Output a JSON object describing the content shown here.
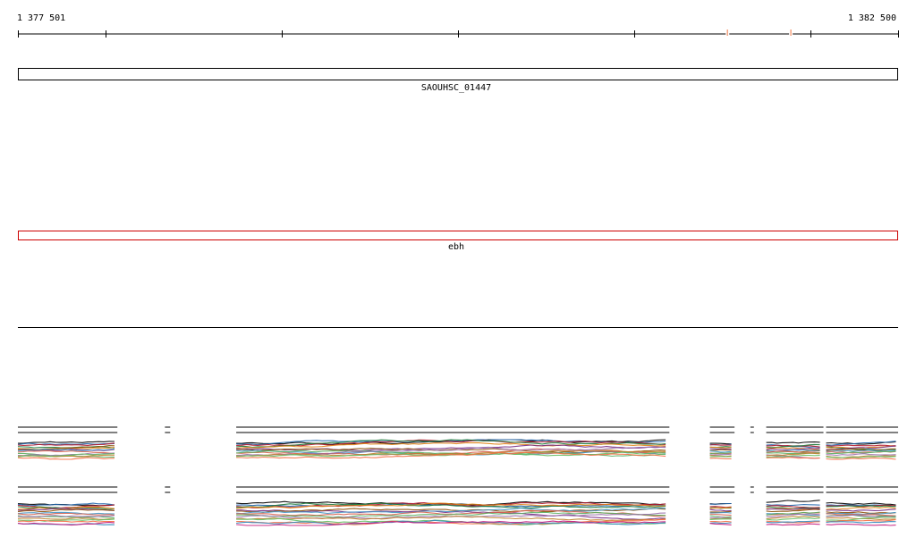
{
  "ruler": {
    "start_label": "1 377 501",
    "end_label": "1 382 500",
    "start": 1377501,
    "end": 1382500,
    "ticks": [
      1377501,
      1378001,
      1379001,
      1380001,
      1381001,
      1382001,
      1382500
    ],
    "marks": [
      1381531,
      1381891
    ],
    "mark_color": "#f4a582"
  },
  "features": [
    {
      "name": "SAOUHSC_01447",
      "start": 1377501,
      "end": 1382500,
      "color": "#000000"
    },
    {
      "name": "ebh",
      "start": 1377501,
      "end": 1382500,
      "color": "#cc0000"
    }
  ],
  "tracks": {
    "gaps": [
      [
        1378066,
        1378336
      ],
      [
        1378366,
        1378741
      ],
      [
        1381201,
        1381431
      ],
      [
        1381571,
        1381661
      ],
      [
        1381681,
        1381751
      ],
      [
        1382076,
        1382091
      ]
    ],
    "colors": [
      "#000000",
      "#2166ac",
      "#b2182b",
      "#1b7837",
      "#e08214",
      "#762a83",
      "#8c510a",
      "#4393c3",
      "#d6604d",
      "#5aae61",
      "#9970ab",
      "#bf812d",
      "#66bd63",
      "#f46d43",
      "#3288bd",
      "#c51b7d"
    ]
  }
}
